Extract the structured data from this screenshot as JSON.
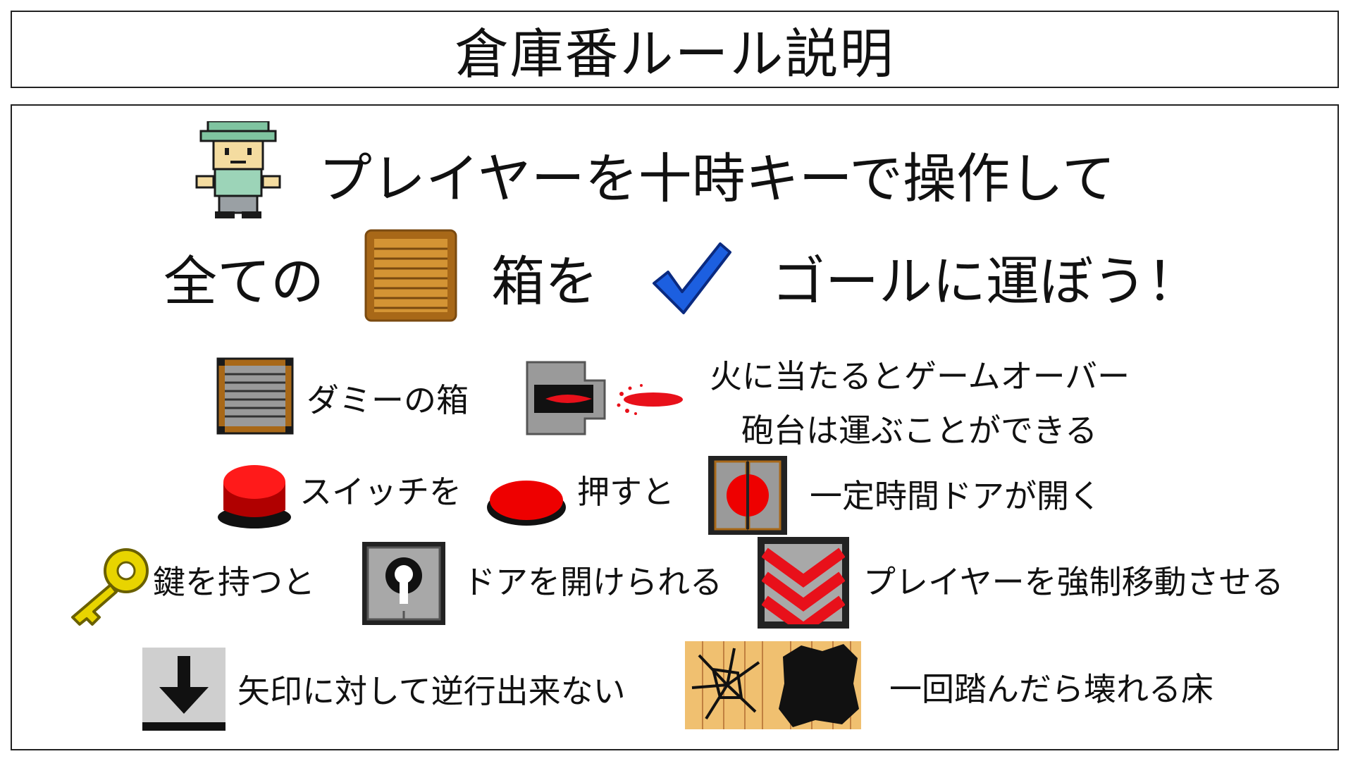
{
  "title": "倉庫番ルール説明",
  "intro": {
    "line1": "プレイヤーを十時キーで操作して",
    "line2_a": "全ての",
    "line2_b": "箱を",
    "line2_c": "ゴールに運ぼう！"
  },
  "rules": {
    "dummy_box": "ダミーの箱",
    "cannon_1": "火に当たるとゲームオーバー",
    "cannon_2": "砲台は運ぶことができる",
    "switch_a": "スイッチを",
    "switch_b": "押すと",
    "switch_c": "一定時間ドアが開く",
    "key_a": "鍵を持つと",
    "key_b": "ドアを開けられる",
    "conveyor": "プレイヤーを強制移動させる",
    "arrow": "矢印に対して逆行出来ない",
    "floor": "一回踏んだら壊れる床"
  },
  "colors": {
    "crate_brown": "#c8862a",
    "check_blue": "#1c5fe0",
    "switch_red": "#e00000",
    "key_yellow": "#e8d400",
    "fire_red": "#e8101a",
    "floor_tan": "#f0c070"
  },
  "icons": [
    "player-icon",
    "crate-icon",
    "goal-check-icon",
    "dummy-box-icon",
    "cannon-icon",
    "fire-icon",
    "switch-up-icon",
    "switch-pressed-icon",
    "timed-door-icon",
    "key-icon",
    "key-door-icon",
    "conveyor-icon",
    "arrow-tile-icon",
    "cracked-floor-icon",
    "broken-floor-icon"
  ]
}
